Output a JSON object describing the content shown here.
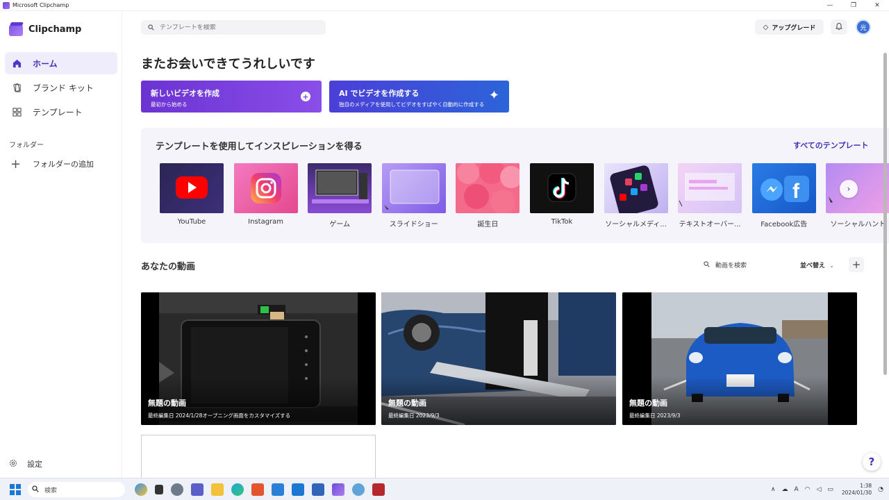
{
  "window": {
    "title": "Microsoft Clipchamp",
    "controls": [
      "—",
      "❐",
      "✕"
    ]
  },
  "sidebar": {
    "brand": "Clipchamp",
    "items": [
      {
        "label": "ホーム",
        "icon": "home-icon",
        "active": true
      },
      {
        "label": "ブランド キット",
        "icon": "brand-kit-icon",
        "active": false
      },
      {
        "label": "テンプレート",
        "icon": "templates-icon",
        "active": false
      }
    ],
    "folders_header": "フォルダー",
    "add_folder": "フォルダーの追加",
    "settings": "設定"
  },
  "header": {
    "search_placeholder": "テンプレートを検索",
    "upgrade_label": "アップグレード",
    "avatar_initial": "光"
  },
  "main": {
    "greeting": "またお会いできてうれしいです",
    "cta_new": {
      "title": "新しいビデオを作成",
      "subtitle": "最初から始める"
    },
    "cta_ai": {
      "title": "AI でビデオを作成する",
      "subtitle": "独自のメディアを使用してビデオをすばやく自動的に作成する"
    },
    "templates": {
      "title": "テンプレートを使用してインスピレーションを得る",
      "see_all": "すべてのテンプレート",
      "items": [
        {
          "name": "YouTube"
        },
        {
          "name": "Instagram"
        },
        {
          "name": "ゲーム"
        },
        {
          "name": "スライドショー"
        },
        {
          "name": "誕生日"
        },
        {
          "name": "TikTok"
        },
        {
          "name": "ソーシャルメディ..."
        },
        {
          "name": "テキストオーバー..."
        },
        {
          "name": "Facebook広告"
        },
        {
          "name": "ソーシャルハント"
        }
      ]
    },
    "videos": {
      "title": "あなたの動画",
      "search_label": "動画を検索",
      "sort_label": "並べ替え",
      "items": [
        {
          "title": "無題の動画",
          "subtitle": "最終編集日 2024/1/28オープニング画面をカスタマイズする"
        },
        {
          "title": "無題の動画",
          "subtitle": "最終編集日 2023/9/3"
        },
        {
          "title": "無題の動画",
          "subtitle": "最終編集日 2023/9/3"
        }
      ]
    },
    "help_label": "?"
  },
  "taskbar": {
    "search_label": "検索",
    "tray_ime": "A",
    "clock_time": "1:38",
    "clock_date": "2024/01/30"
  }
}
